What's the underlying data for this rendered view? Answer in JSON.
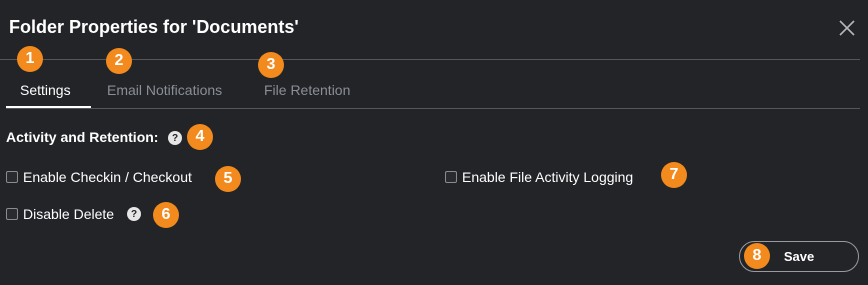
{
  "dialog": {
    "title": "Folder Properties for 'Documents'",
    "close_icon": "close-icon"
  },
  "tabs": [
    {
      "label": "Settings",
      "active": true
    },
    {
      "label": "Email Notifications",
      "active": false
    },
    {
      "label": "File Retention",
      "active": false
    }
  ],
  "section": {
    "title": "Activity and Retention:",
    "help_glyph": "?"
  },
  "options": {
    "checkin": {
      "label": "Enable Checkin / Checkout",
      "checked": false
    },
    "delete": {
      "label": "Disable Delete",
      "checked": false,
      "help_glyph": "?"
    },
    "logging": {
      "label": "Enable File Activity Logging",
      "checked": false
    }
  },
  "save_label": "Save",
  "badges": [
    "1",
    "2",
    "3",
    "4",
    "5",
    "6",
    "7",
    "8"
  ],
  "colors": {
    "background": "#232428",
    "badge": "#f28a1e",
    "text": "#ffffff",
    "muted_text": "#8a8e96",
    "divider": "#55565c"
  }
}
